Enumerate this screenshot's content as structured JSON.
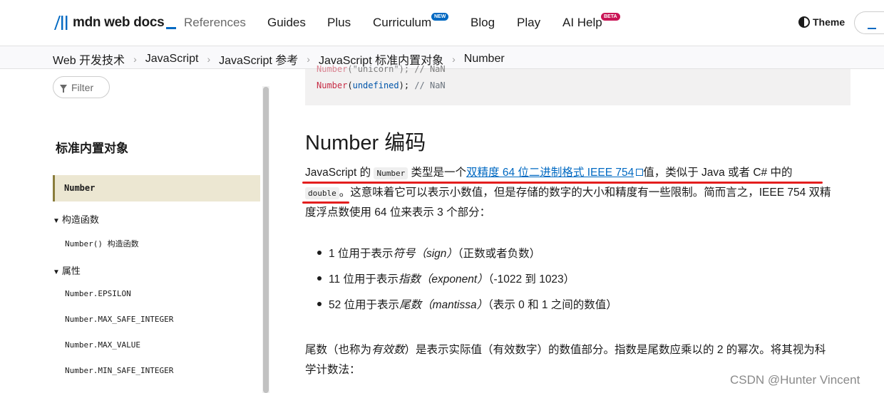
{
  "header": {
    "logo_text": "mdn web docs",
    "nav": [
      "References",
      "Guides",
      "Plus",
      "Curriculum",
      "Blog",
      "Play",
      "AI Help"
    ],
    "badge_new": "NEW",
    "badge_beta": "BETA",
    "theme_label": "Theme"
  },
  "breadcrumb": [
    "Web 开发技术",
    "JavaScript",
    "JavaScript 参考",
    "JavaScript 标准内置对象",
    "Number"
  ],
  "sidebar": {
    "filter_label": "Filter",
    "heading": "标准内置对象",
    "active_item": "Number",
    "group_constructor": "构造函数",
    "constructor_item": "Number() 构造函数",
    "group_properties": "属性",
    "properties": [
      "Number.EPSILON",
      "Number.MAX_SAFE_INTEGER",
      "Number.MAX_VALUE",
      "Number.MIN_SAFE_INTEGER"
    ]
  },
  "code": {
    "line1_fn": "Number",
    "line1_rest": "(\"unicorn\"); // NaN",
    "line2_fn": "Number",
    "line2_open": "(",
    "line2_kw": "undefined",
    "line2_close": "); ",
    "line2_comment": "// NaN"
  },
  "content": {
    "heading": "Number 编码",
    "p1_a": "JavaScript 的 ",
    "p1_code1": "Number",
    "p1_b": " 类型是一个",
    "p1_link": "双精度 64 位二进制格式 IEEE 754",
    "p1_c": "值，类似于 Java 或者 C# 中的",
    "p1_code2": "double",
    "p1_d": "。这意味着它可以表示小数值，但是存储的数字的大小和精度有一些限制。简而言之，IEEE 754 双精",
    "p1_e": "度浮点数使用 64 位来表示 3 个部分：",
    "list": [
      {
        "pre": "1 位用于表示",
        "em": "符号（sign）",
        "post": "（正数或者负数）"
      },
      {
        "pre": "11 位用于表示",
        "em": "指数（exponent）",
        "post": "（-1022 到 1023）"
      },
      {
        "pre": "52 位用于表示",
        "em": "尾数（mantissa）",
        "post": "（表示 0 和 1 之间的数值）"
      }
    ],
    "p2_a": "尾数（也称为",
    "p2_em": "有效数",
    "p2_b": "）是表示实际值（有效数字）的数值部分。指数是尾数应乘以的 2 的幂次。将其视为科",
    "p2_c": "学计数法："
  },
  "watermark": "CSDN @Hunter Vincent",
  "colors": {
    "link": "#0069c2",
    "annotation": "#e41e1e",
    "active_bg": "#ece7d2"
  }
}
